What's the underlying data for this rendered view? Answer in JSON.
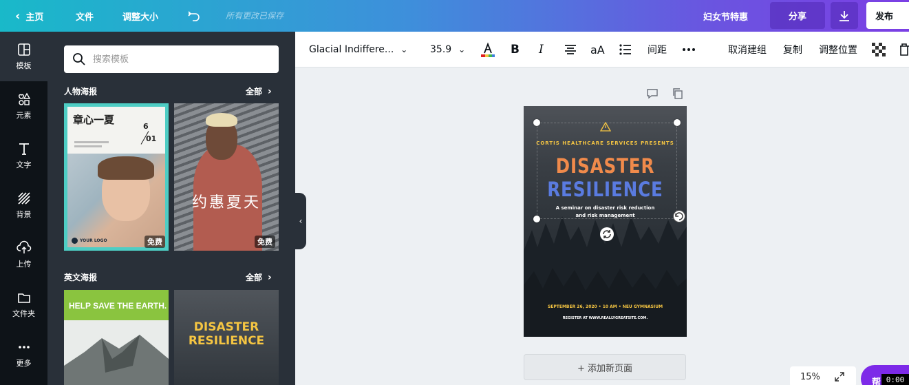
{
  "topbar": {
    "home": "主页",
    "file": "文件",
    "resize": "调整大小",
    "saved_status": "所有更改已保存",
    "design_title": "妇女节特惠",
    "share": "分享",
    "publish": "发布"
  },
  "rail": {
    "items": [
      {
        "label": "模板",
        "icon": "template-icon"
      },
      {
        "label": "元素",
        "icon": "elements-icon"
      },
      {
        "label": "文字",
        "icon": "text-icon"
      },
      {
        "label": "背景",
        "icon": "background-icon"
      },
      {
        "label": "上传",
        "icon": "upload-icon"
      },
      {
        "label": "文件夹",
        "icon": "folder-icon"
      },
      {
        "label": "更多",
        "icon": "more-icon"
      }
    ]
  },
  "panel": {
    "search_placeholder": "搜索模板",
    "sections": [
      {
        "title": "人物海报",
        "all": "全部"
      },
      {
        "title": "英文海报",
        "all": "全部"
      }
    ],
    "thumbs": {
      "t1_title": "章心一夏",
      "t1_date_top": "6",
      "t1_date_bottom": "01",
      "t1_logo": "YOUR LOGO",
      "t2_title": "约惠夏天",
      "free": "免费",
      "t3_title": "HELP SAVE THE EARTH.",
      "t4_title_1": "DISASTER",
      "t4_title_2": "RESILIENCE"
    }
  },
  "toolbar": {
    "font": "Glacial Indiffere...",
    "size": "35.9",
    "spacing": "间距",
    "ungroup": "取消建组",
    "copy": "复制",
    "position": "调整位置",
    "text_color": "#e02020"
  },
  "poster": {
    "presenter": "CORTIS HEALTHCARE SERVICES PRESENTS",
    "title_1": "DISASTER",
    "title_2": "RESILIENCE",
    "sub_1": "A seminar on disaster risk reduction",
    "sub_2": "and risk management",
    "date_line": "SEPTEMBER 26, 2020 • 10 AM • NEU GYMNASIUM",
    "register": "REGISTER AT WWW.REALLYGREATSITE.COM.",
    "color_title_1": "#f08a4b",
    "color_title_2": "#5a7be0",
    "color_accent": "#f5c542"
  },
  "canvas": {
    "add_page": "+ 添加新页面",
    "zoom": "15%",
    "help": "帮",
    "timer": "0:00"
  }
}
